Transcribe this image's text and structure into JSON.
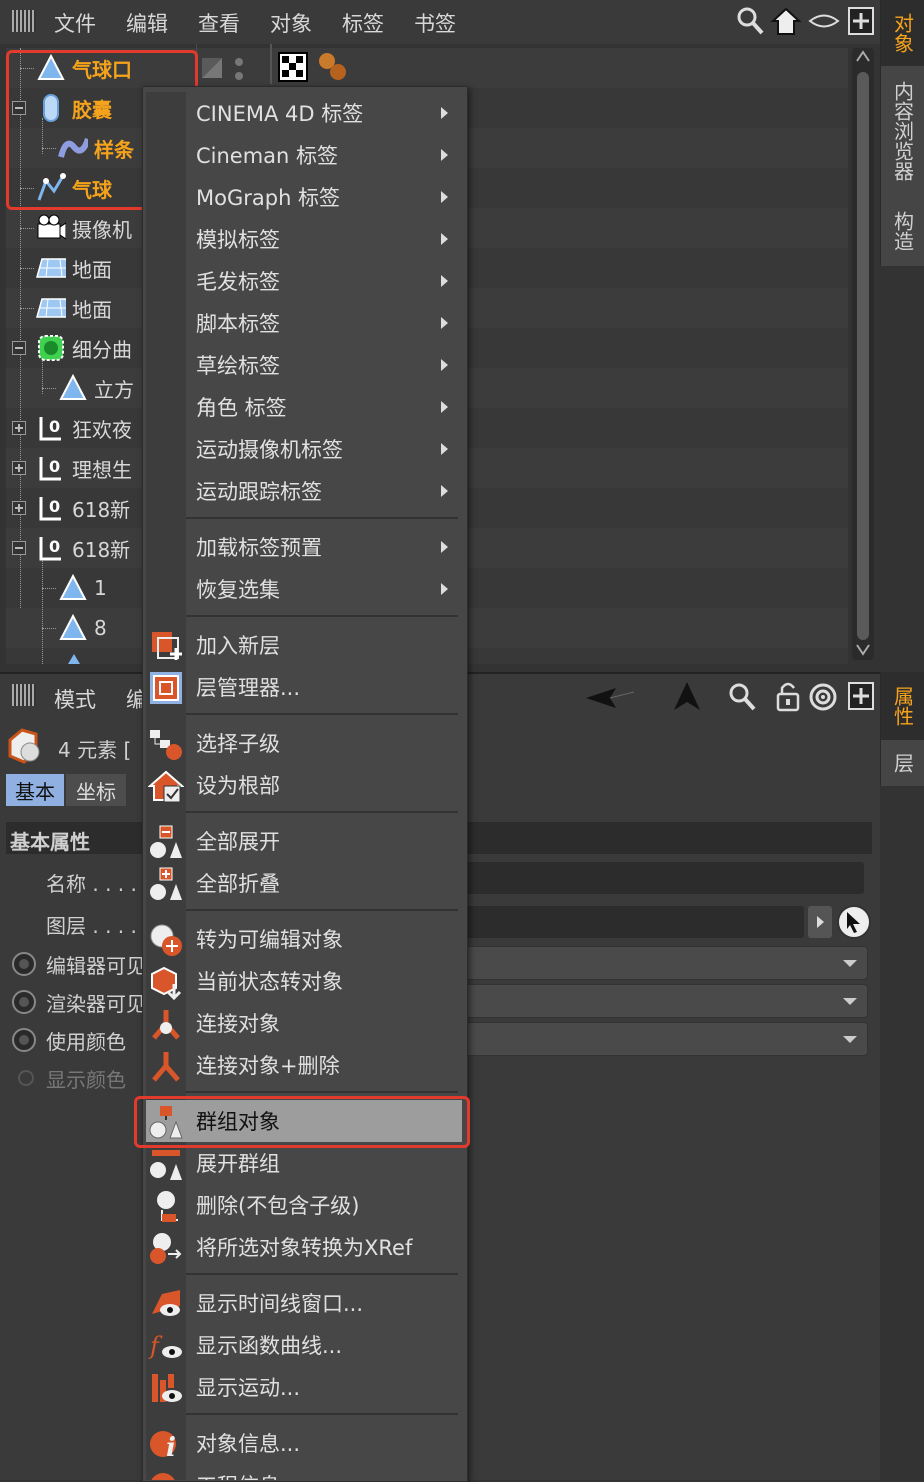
{
  "top_menu": {
    "items": [
      "文件",
      "编辑",
      "查看",
      "对象",
      "标签",
      "书签"
    ]
  },
  "objects": [
    {
      "label": "气球口",
      "icon": "polygon-object-icon",
      "selected": true
    },
    {
      "label": "胶囊",
      "icon": "capsule-icon",
      "selected": true
    },
    {
      "label": "样条",
      "icon": "spline-icon",
      "selected": true
    },
    {
      "label": "气球",
      "icon": "spline-pen-icon",
      "selected": true
    },
    {
      "label": "摄像机",
      "icon": "camera-icon",
      "selected": false
    },
    {
      "label": "地面",
      "icon": "floor-icon",
      "selected": false
    },
    {
      "label": "地面",
      "icon": "floor-icon",
      "selected": false
    },
    {
      "label": "细分曲",
      "icon": "subdivision-surface-icon",
      "selected": false
    },
    {
      "label": "立方",
      "icon": "polygon-object-icon",
      "selected": false
    },
    {
      "label": "狂欢夜",
      "icon": "null-object-icon",
      "selected": false
    },
    {
      "label": "理想生",
      "icon": "null-object-icon",
      "selected": false
    },
    {
      "label": "618新",
      "icon": "null-object-icon",
      "selected": false
    },
    {
      "label": "618新",
      "icon": "null-object-icon",
      "selected": false
    },
    {
      "label": "1",
      "icon": "polygon-object-icon",
      "selected": false
    },
    {
      "label": "8",
      "icon": "polygon-object-icon",
      "selected": false
    }
  ],
  "side_tabs_top": [
    "对象",
    "内容浏览器",
    "构造"
  ],
  "side_tabs_bottom": [
    "属性",
    "层"
  ],
  "attr": {
    "mode_label": "模式",
    "edit_label": "编",
    "element_count": "4 元素 [",
    "tabs": [
      "基本",
      "坐标"
    ],
    "section_title": "基本属性",
    "name_label": "名称 . . . .",
    "layer_label": "图层 . . . .",
    "editor_visible": "编辑器可见",
    "render_visible": "渲染器可见",
    "use_color": "使用颜色",
    "display_color": "显示颜色"
  },
  "context_menu": {
    "groups": [
      [
        {
          "label": "CINEMA 4D 标签",
          "submenu": true
        },
        {
          "label": "Cineman 标签",
          "submenu": true
        },
        {
          "label": "MoGraph 标签",
          "submenu": true
        },
        {
          "label": "模拟标签",
          "submenu": true
        },
        {
          "label": "毛发标签",
          "submenu": true
        },
        {
          "label": "脚本标签",
          "submenu": true
        },
        {
          "label": "草绘标签",
          "submenu": true
        },
        {
          "label": "角色 标签",
          "submenu": true
        },
        {
          "label": "运动摄像机标签",
          "submenu": true
        },
        {
          "label": "运动跟踪标签",
          "submenu": true
        }
      ],
      [
        {
          "label": "加载标签预置",
          "submenu": true
        },
        {
          "label": "恢复选集",
          "submenu": true
        }
      ],
      [
        {
          "label": "加入新层",
          "icon": "add-layer-icon"
        },
        {
          "label": "层管理器...",
          "icon": "layer-manager-icon"
        }
      ],
      [
        {
          "label": "选择子级",
          "icon": "select-children-icon"
        },
        {
          "label": "设为根部",
          "icon": "set-root-icon"
        }
      ],
      [
        {
          "label": "全部展开",
          "icon": "expand-all-icon"
        },
        {
          "label": "全部折叠",
          "icon": "collapse-all-icon"
        }
      ],
      [
        {
          "label": "转为可编辑对象",
          "icon": "make-editable-icon"
        },
        {
          "label": "当前状态转对象",
          "icon": "current-state-icon"
        },
        {
          "label": "连接对象",
          "icon": "connect-objects-icon"
        },
        {
          "label": "连接对象+删除",
          "icon": "connect-delete-icon"
        }
      ],
      [
        {
          "label": "群组对象",
          "icon": "group-objects-icon",
          "highlighted": true
        },
        {
          "label": "展开群组",
          "icon": "expand-group-icon"
        },
        {
          "label": "删除(不包含子级)",
          "icon": "delete-no-children-icon"
        },
        {
          "label": "将所选对象转换为XRef",
          "icon": "xref-icon"
        }
      ],
      [
        {
          "label": "显示时间线窗口...",
          "icon": "timeline-icon"
        },
        {
          "label": "显示函数曲线...",
          "icon": "fcurve-icon"
        },
        {
          "label": "显示运动...",
          "icon": "motion-icon"
        }
      ],
      [
        {
          "label": "对象信息...",
          "icon": "object-info-icon"
        },
        {
          "label": "工程信息",
          "icon": "project-info-icon"
        }
      ]
    ]
  },
  "colors": {
    "selected_text": "#f6a31c",
    "annotation_red": "#e23a2c",
    "menu_bg": "#474747",
    "menu_highlight": "#9d9d9d"
  }
}
